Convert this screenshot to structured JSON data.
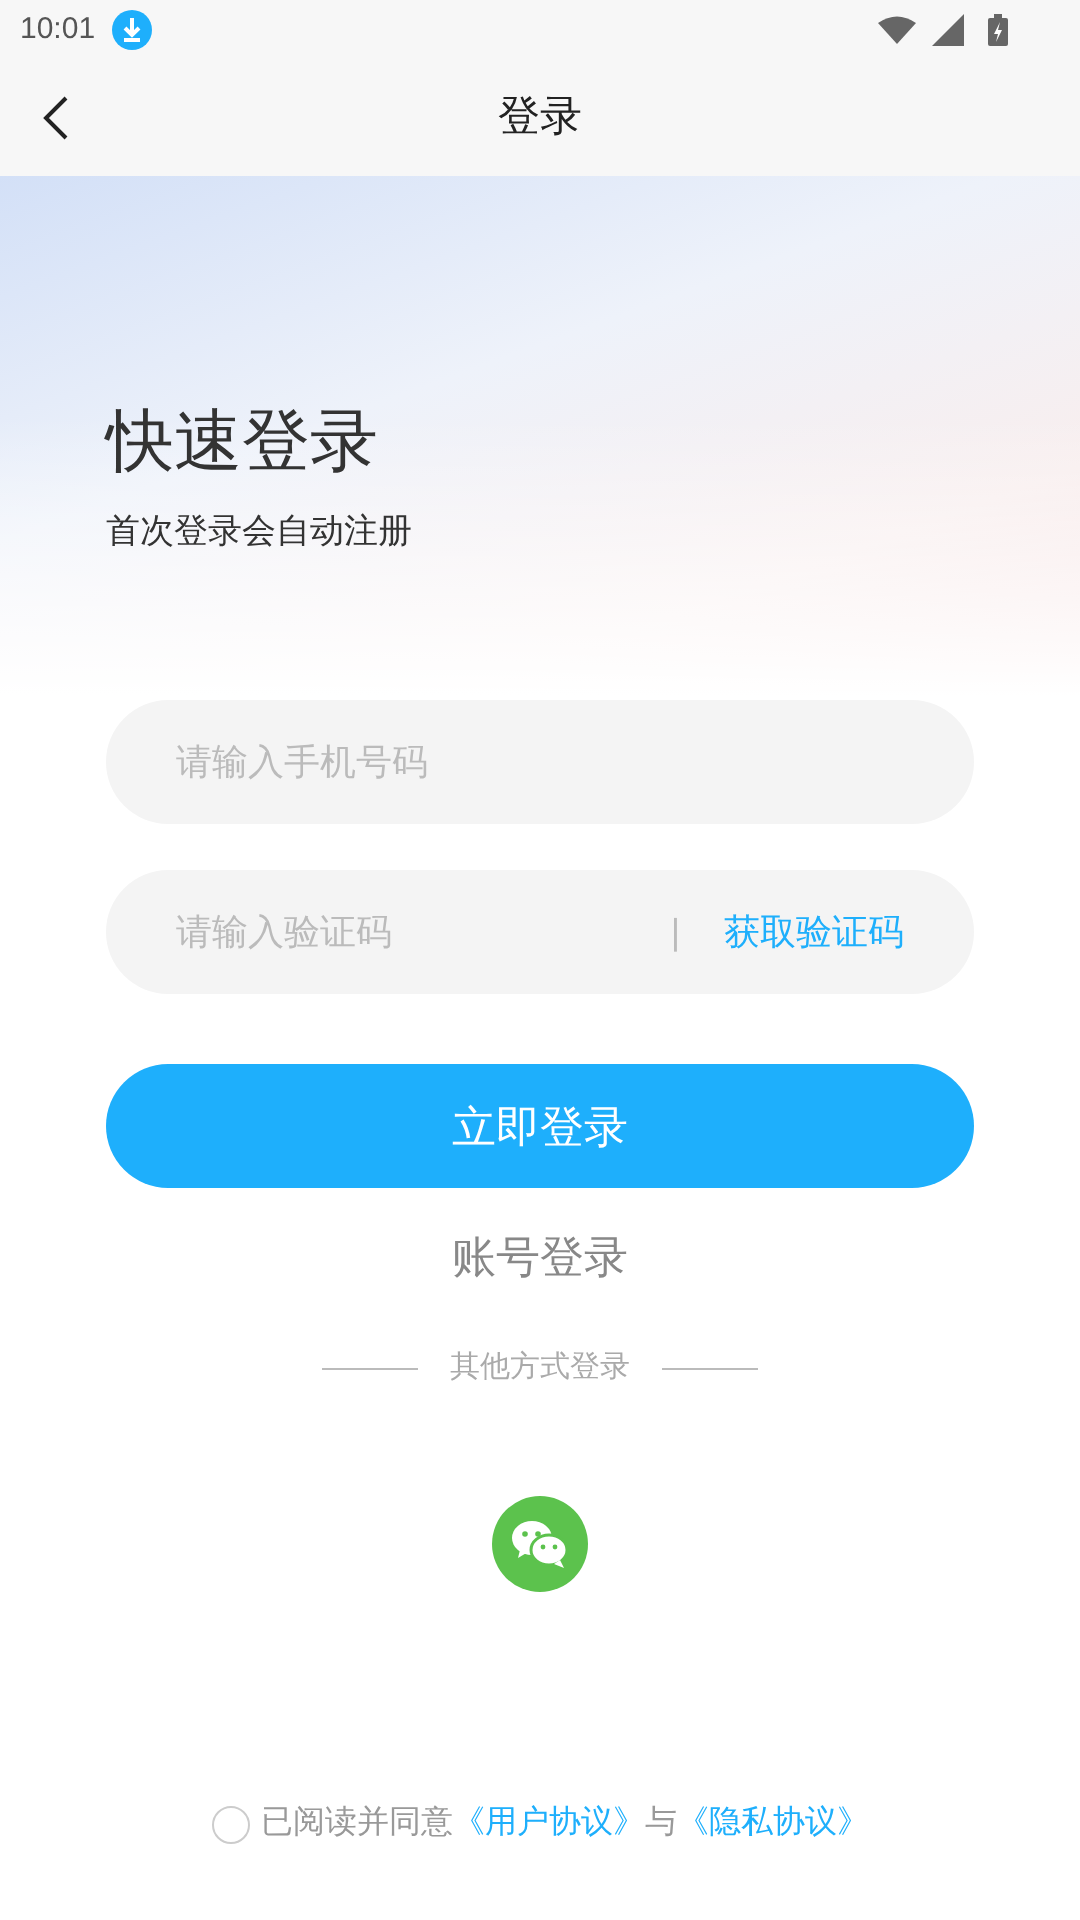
{
  "status_bar": {
    "time": "10:01"
  },
  "nav": {
    "title": "登录"
  },
  "header": {
    "title": "快速登录",
    "subtitle": "首次登录会自动注册"
  },
  "phone_field": {
    "placeholder": "请输入手机号码"
  },
  "code_field": {
    "placeholder": "请输入验证码",
    "separator": "|",
    "action": "获取验证码"
  },
  "login_button": "立即登录",
  "account_login": "账号登录",
  "other_methods": "其他方式登录",
  "agreement": {
    "checked": false,
    "parts": [
      {
        "kind": "text",
        "text": "已阅读并同意"
      },
      {
        "kind": "link",
        "text": "《用户协议》"
      },
      {
        "kind": "text",
        "text": "与"
      },
      {
        "kind": "link",
        "text": "《隐私协议》"
      }
    ]
  }
}
